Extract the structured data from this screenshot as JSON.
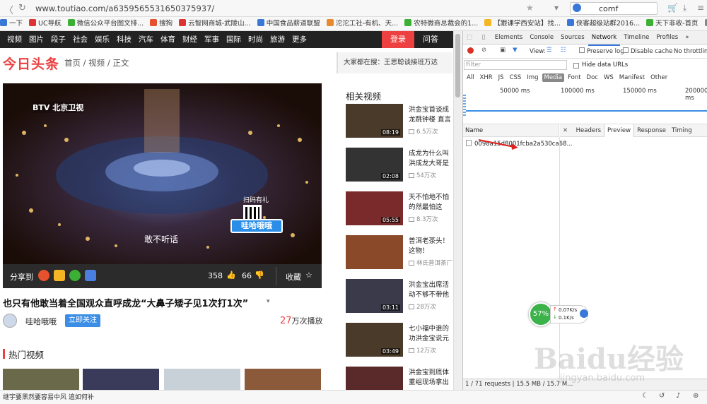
{
  "browser": {
    "url": "www.toutiao.com/a6359565531650375937/",
    "search_query": "comf",
    "bookmarks": [
      "一下",
      "UC导航",
      "微信公众平台图文排...",
      "搜狗",
      "云智网商城-武陵山...",
      "中国食品薪道联盟",
      "沱沱工社-有机、天...",
      "农特微商总裁会的1...",
      "【跟课学西安站】找...",
      "侠客超级站群2016...",
      "天下非收-首页",
      "移动"
    ],
    "status_text": "继宇要黑然要容易中风 追如何补"
  },
  "site": {
    "nav": [
      "视频",
      "图片",
      "段子",
      "社会",
      "娱乐",
      "科技",
      "汽车",
      "体育",
      "财经",
      "军事",
      "国际",
      "时尚",
      "旅游",
      "更多"
    ],
    "login": "登录",
    "qa": "问答",
    "logo": "今日头条",
    "breadcrumb": "首页 / 视频 / 正文",
    "hot_search": "大家都在搜：王思聪谈接班万达",
    "video": {
      "channel": "BTV 北京卫视",
      "subtitle": "敢不听话",
      "overlay_badge": "哇哈哦哦",
      "qr_text": "扫码有礼"
    },
    "controls": {
      "share": "分享到",
      "likes": "358",
      "dislikes": "66",
      "collect": "收藏"
    },
    "title": "也只有他敢当着全国观众直呼成龙“大鼻子矮子见1次打1次”",
    "author": "哇哈哦哦",
    "follow": "立即关注",
    "plays_num": "27",
    "plays_unit": "万次播放",
    "hot_videos": "热门视频",
    "related_header": "相关视频",
    "related": [
      {
        "title": "洪金宝首谈成龙跳钟楼 直言成",
        "dur": "08:19",
        "count": "6.5万次",
        "color": "#4a3a2a"
      },
      {
        "title": "成龙为什么叫洪成龙大哥是这样",
        "dur": "02:08",
        "count": "54万次",
        "color": "#333"
      },
      {
        "title": "天不怕地不怕的然最怕这个，",
        "dur": "05:55",
        "count": "8.3万次",
        "color": "#7a2a2a"
      },
      {
        "title": "普洱老茶头！这物！",
        "dur": "",
        "count": "林氏普洱茶厂",
        "color": "#8a4a2a"
      },
      {
        "title": "洪金宝出席活动不够不带他 还",
        "dur": "03:11",
        "count": "28万次",
        "color": "#3a3a4a"
      },
      {
        "title": "七小福中谁的功洪金宝说元彪",
        "dur": "03:49",
        "count": "12万次",
        "color": "#4a3a2a"
      },
      {
        "title": "洪金宝到底体重组现场拿出体重",
        "dur": "",
        "count": "",
        "color": "#5a2a2a"
      }
    ]
  },
  "devtools": {
    "tabs": [
      "Elements",
      "Console",
      "Sources",
      "Network",
      "Timeline",
      "Profiles"
    ],
    "active_tab": "Network",
    "view_label": "View:",
    "preserve_log": "Preserve log",
    "disable_cache": "Disable cache",
    "throttling": "No throttling",
    "filter_placeholder": "Filter",
    "hide_data_urls": "Hide data URLs",
    "types": [
      "All",
      "XHR",
      "JS",
      "CSS",
      "Img",
      "Media",
      "Font",
      "Doc",
      "WS",
      "Manifest",
      "Other"
    ],
    "timeline_ticks": [
      "50000 ms",
      "100000 ms",
      "150000 ms",
      "200000 ms"
    ],
    "name_header": "Name",
    "request": "0098a15d8001fcba2a530ca68...",
    "detail_tabs": [
      "Headers",
      "Preview",
      "Response",
      "Timing"
    ],
    "status": "1 / 71 requests | 15.5 MB / 15.7 M..."
  },
  "netmonitor": {
    "percent": "57%",
    "up": "0.07K/s",
    "down": "0.1K/s"
  },
  "watermark": {
    "main": "Baidu经验",
    "sub": "jingyan.baidu.com"
  }
}
